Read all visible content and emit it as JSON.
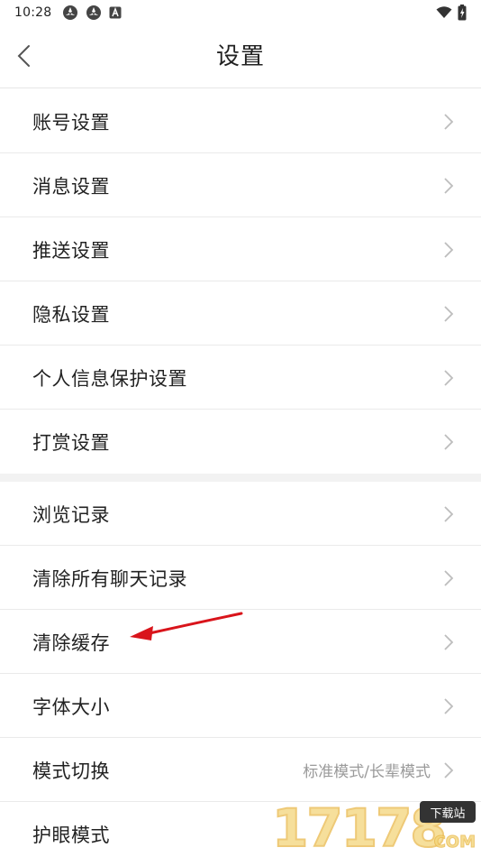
{
  "status_bar": {
    "time": "10:28"
  },
  "header": {
    "title": "设置"
  },
  "groups": [
    {
      "items": [
        {
          "label": "账号设置"
        },
        {
          "label": "消息设置"
        },
        {
          "label": "推送设置"
        },
        {
          "label": "隐私设置"
        },
        {
          "label": "个人信息保护设置"
        },
        {
          "label": "打赏设置"
        }
      ]
    },
    {
      "items": [
        {
          "label": "浏览记录"
        },
        {
          "label": "清除所有聊天记录"
        },
        {
          "label": "清除缓存"
        },
        {
          "label": "字体大小"
        },
        {
          "label": "模式切换",
          "value": "标准模式/长辈模式"
        },
        {
          "label": "护眼模式"
        }
      ]
    }
  ],
  "watermark": {
    "digits": "17178",
    "badge": "下载站",
    "suffix": "COM"
  },
  "colors": {
    "annotation_arrow": "#d9141b",
    "divider": "#eaeaea",
    "group_gap": "#f2f2f2"
  }
}
